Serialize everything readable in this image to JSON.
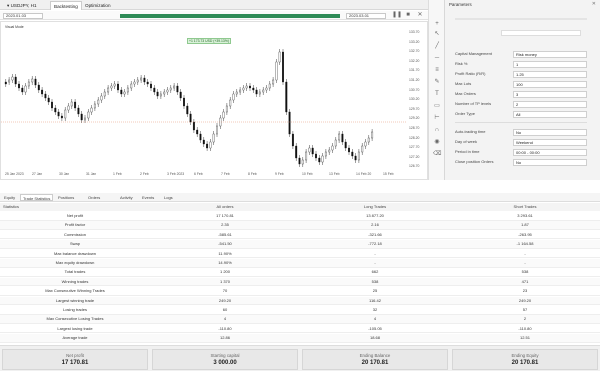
{
  "top": {
    "symbol": "USDJPY, H1",
    "tabs": [
      "Backtesting",
      "Optimization"
    ],
    "date_from": "2023.01.03",
    "date_to": "2023.03.01",
    "progress": 1.0
  },
  "chart": {
    "label": "Visual Mode",
    "badge": "+1 173.73 USD (+39.13%)",
    "y_ticks": [
      "133.70",
      "133.20",
      "132.70",
      "132.20",
      "131.70",
      "131.20",
      "130.70",
      "130.20",
      "129.70",
      "129.20",
      "128.70",
      "128.20",
      "127.70",
      "127.20",
      "126.70"
    ],
    "x_ticks": [
      "25 Jan 2023",
      "27 Jan",
      "30 Jan",
      "31 Jan",
      "1 Feb",
      "2 Feb",
      "3 Feb 2023",
      "6 Feb",
      "7 Feb",
      "8 Feb",
      "9 Feb",
      "10 Feb",
      "13 Feb",
      "14 Feb 20",
      "15 Feb"
    ]
  },
  "settings": {
    "title": "Parameters",
    "rows": [
      {
        "label": "Capital Management",
        "value": "Risk money"
      },
      {
        "label": "Risk %",
        "value": "1"
      },
      {
        "label": "Profit Ratio (R/R)",
        "value": "1.25"
      },
      {
        "label": "Max Lots",
        "value": "100"
      },
      {
        "label": "Max Orders",
        "value": "3"
      },
      {
        "label": "Number of TP levels",
        "value": "2"
      },
      {
        "label": "Order Type",
        "value": "All"
      }
    ],
    "rows2": [
      {
        "label": "Auto-trading time",
        "value": "No"
      },
      {
        "label": "Day of week",
        "value": "Weekend"
      },
      {
        "label": "Period in time",
        "value": "00:00 - 00:00"
      },
      {
        "label": "Close position Orders",
        "value": "No"
      }
    ]
  },
  "bottom_tabs": [
    "Equity",
    "Trade Statistics",
    "Positions",
    "Orders",
    "Activity",
    "Events",
    "Logs"
  ],
  "table": {
    "headers": [
      "Statistics",
      "All orders",
      "Long Trades",
      "Short Trades"
    ],
    "rows": [
      [
        "Net profit",
        "17 170.81",
        "13 877.20",
        "3 293.61"
      ],
      [
        "Profit factor",
        "2.35",
        "2.16",
        "1.87"
      ],
      [
        "Commission",
        "-585.61",
        "-321.66",
        "-263.95"
      ],
      [
        "Swap",
        "-541.50",
        "-772.18",
        "-1 164.58"
      ],
      [
        "Max balance drawdown",
        "11.90%",
        "-",
        "-"
      ],
      [
        "Max equity drawdown",
        "14.90%",
        "-",
        "-"
      ],
      [
        "Total trades",
        "1 200",
        "662",
        "538"
      ],
      [
        "Winning trades",
        "1 370",
        "538",
        "471"
      ],
      [
        "Max Consecutive Winning Trades",
        "70",
        "25",
        "23"
      ],
      [
        "Largest winning trade",
        "249.20",
        "116.42",
        "249.20"
      ],
      [
        "Losing trades",
        "60",
        "32",
        "57"
      ],
      [
        "Max Consecutive Losing Trades",
        "4",
        "4",
        "2"
      ],
      [
        "Largest losing trade",
        "-110.80",
        "-105.05",
        "-110.80"
      ],
      [
        "Average trade",
        "12.86",
        "18.68",
        "12.51"
      ]
    ]
  },
  "summary": [
    {
      "label": "Net profit",
      "value": "17 170.81"
    },
    {
      "label": "Starting capital",
      "value": "3 000.00"
    },
    {
      "label": "Ending Balance",
      "value": "20 170.81"
    },
    {
      "label": "Ending Equity",
      "value": "20 170.81"
    }
  ]
}
